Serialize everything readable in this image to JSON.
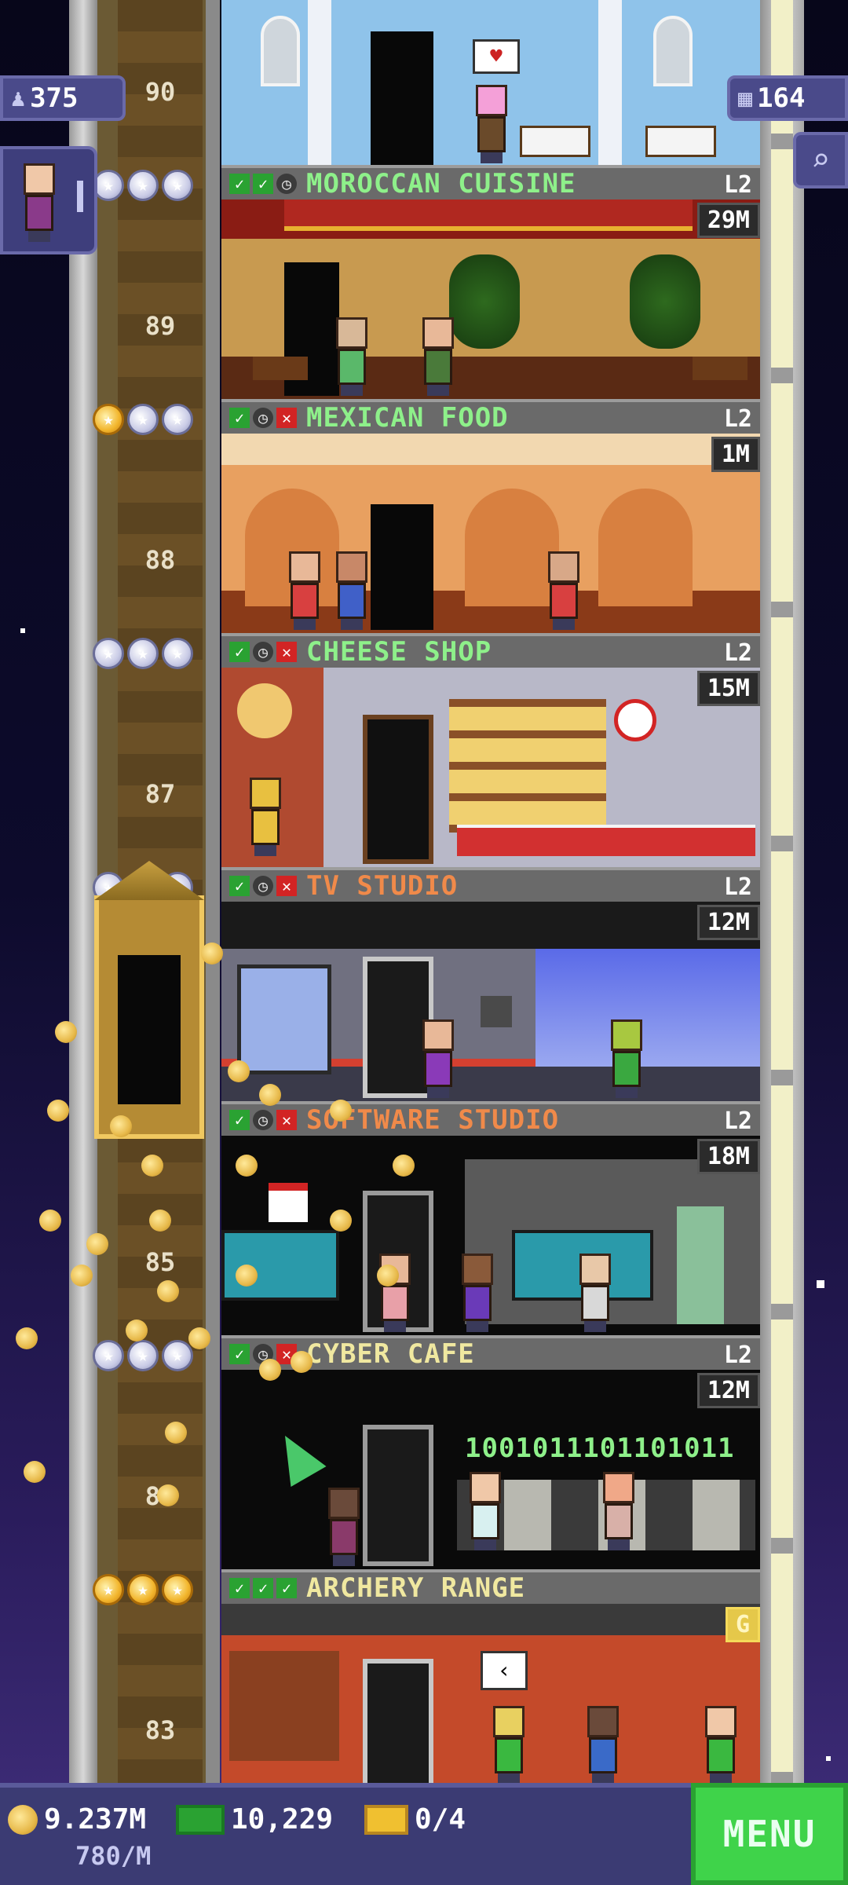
{
  "hud": {
    "population": "375",
    "floor_count": "164",
    "coins": "9.237M",
    "income_rate": "780/M",
    "bux": "10,229",
    "tickets": "0/4",
    "menu_label": "MENU"
  },
  "elevator_numbers": [
    "90",
    "89",
    "88",
    "87",
    "85",
    "84",
    "83"
  ],
  "floors": [
    {
      "name": "MOROCCAN CUISINE",
      "level": "L2",
      "stock": "29M",
      "checks": [
        "yes",
        "yes",
        "clock"
      ],
      "stars": [
        "silver",
        "silver",
        "silver"
      ]
    },
    {
      "name": "MEXICAN FOOD",
      "level": "L2",
      "stock": "1M",
      "checks": [
        "yes",
        "clock",
        "no"
      ],
      "stars": [
        "gold",
        "silver",
        "silver"
      ]
    },
    {
      "name": "CHEESE SHOP",
      "level": "L2",
      "stock": "15M",
      "checks": [
        "yes",
        "clock",
        "no"
      ],
      "stars": [
        "silver",
        "silver",
        "silver"
      ]
    },
    {
      "name": "TV STUDIO",
      "level": "L2",
      "stock": "12M",
      "checks": [
        "yes",
        "clock",
        "no"
      ],
      "stars": [
        "silver",
        "silver",
        "silver"
      ]
    },
    {
      "name": "SOFTWARE STUDIO",
      "level": "L2",
      "stock": "18M",
      "checks": [
        "yes",
        "clock",
        "no"
      ],
      "stars": [
        "silver",
        "silver",
        "silver"
      ]
    },
    {
      "name": "CYBER CAFE",
      "level": "L2",
      "stock": "12M",
      "checks": [
        "yes",
        "clock",
        "no"
      ],
      "stars": [
        "silver",
        "silver",
        "silver"
      ]
    },
    {
      "name": "ARCHERY RANGE",
      "level": "",
      "stock": "G",
      "checks": [
        "yes",
        "yes",
        "yes"
      ],
      "stars": [
        "gold",
        "gold",
        "gold"
      ]
    }
  ],
  "cyber_cafe_screen_text": "1001011101101011",
  "colors": {
    "floor_name_green": "#8ef08a",
    "floor_name_orange": "#f08a4a",
    "floor_name_yellow": "#f0e8a0",
    "moroccan_room": "#8fc3ea",
    "mexican_room": "#e8a060",
    "cheese_room": "#b8b8c8",
    "tv_room": "#707080",
    "software_room": "#0a0a0a",
    "cyber_room": "#0a0a0a",
    "archery_room": "#c44a2a",
    "menu_green": "#3fd34a",
    "hud_bar": "#3b3b73"
  },
  "icons": {
    "population": "person-icon",
    "floors": "building-icon",
    "search": "magnifier-icon",
    "coins": "coin-icon",
    "bux": "banknote-icon",
    "tickets": "ticket-icon"
  }
}
